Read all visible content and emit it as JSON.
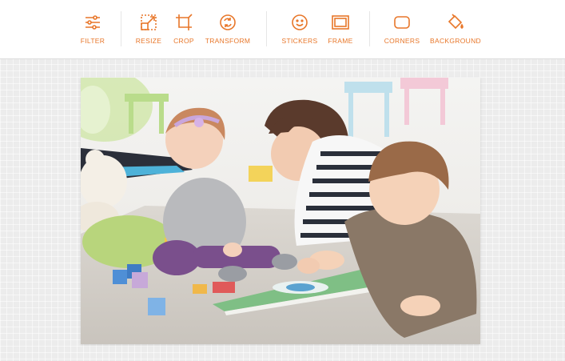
{
  "toolbar": {
    "groups": [
      [
        {
          "label": "FILTER",
          "icon": "sliders-icon"
        }
      ],
      [
        {
          "label": "RESIZE",
          "icon": "resize-icon"
        },
        {
          "label": "CROP",
          "icon": "crop-icon"
        },
        {
          "label": "TRANSFORM",
          "icon": "rotate-icon"
        }
      ],
      [
        {
          "label": "STICKERS",
          "icon": "smiley-icon"
        },
        {
          "label": "FRAME",
          "icon": "frame-icon"
        }
      ],
      [
        {
          "label": "CORNERS",
          "icon": "rounded-square-icon"
        },
        {
          "label": "BACKGROUND",
          "icon": "paint-bucket-icon"
        }
      ]
    ]
  },
  "colors": {
    "accent": "#e8772a",
    "toolbar_bg": "#ffffff",
    "workspace_bg": "#ececec"
  }
}
